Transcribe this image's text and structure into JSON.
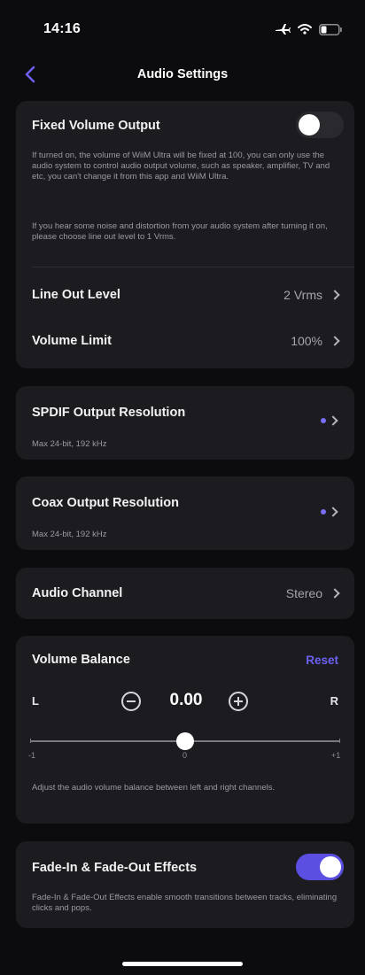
{
  "status_bar": {
    "time": "14:16"
  },
  "nav": {
    "title": "Audio Settings"
  },
  "fixed_volume": {
    "title": "Fixed Volume Output",
    "enabled": false,
    "desc1": "If turned on, the volume of WiiM Ultra will be fixed at 100, you can only use the audio system to control audio output volume, such as speaker, amplifier, TV and etc, you can't change it from this app and WiiM Ultra.",
    "desc2": "If you hear some noise and distortion from your audio system after turning it on, please choose line out level to 1 Vrms."
  },
  "line_out_level": {
    "label": "Line Out Level",
    "value": "2 Vrms"
  },
  "volume_limit": {
    "label": "Volume Limit",
    "value": "100%"
  },
  "spdif": {
    "title": "SPDIF Output Resolution",
    "subtitle": "Max 24-bit, 192 kHz"
  },
  "coax": {
    "title": "Coax Output Resolution",
    "subtitle": "Max 24-bit, 192 kHz"
  },
  "audio_channel": {
    "label": "Audio Channel",
    "value": "Stereo"
  },
  "volume_balance": {
    "title": "Volume Balance",
    "reset_label": "Reset",
    "left_label": "L",
    "right_label": "R",
    "value": "0.00",
    "value_numeric": 0,
    "range": [
      -1,
      1
    ],
    "min_label": "-1",
    "mid_label": "0",
    "max_label": "+1",
    "description": "Adjust the audio volume balance between left and right channels."
  },
  "fade_effects": {
    "title": "Fade-In & Fade-Out Effects",
    "enabled": true,
    "description": "Fade-In & Fade-Out Effects enable smooth transitions between tracks, eliminating clicks and pops."
  },
  "colors": {
    "accent": "#5a4fe0",
    "card": "#1c1c20",
    "background": "#0c0c0e"
  }
}
